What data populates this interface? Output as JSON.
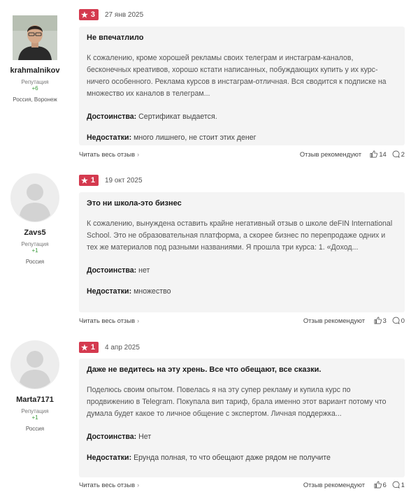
{
  "reviews": [
    {
      "user": {
        "name": "krahmalnikov",
        "rep_label": "Репутация",
        "rep_value": "+6",
        "location": "Россия, Воронеж",
        "avatar": "photo"
      },
      "rating": "3",
      "date": "27 янв 2025",
      "title": "Не впечатлило",
      "text": "К сожалению, кроме хорошей рекламы своих телеграм и инстаграм-каналов, бесконечных креативов, хорошо кстати написанных, побуждающих купить у их курс- ничего особенного. Реклама курсов в инстаграм-отличная. Вся сводится к подписке на множество их каналов в телеграм...",
      "pros_label": "Достоинства:",
      "pros": "Сертификат выдается.",
      "cons_label": "Недостатки:",
      "cons": "много лишнего, не стоит этих денег",
      "read_more": "Читать весь отзыв",
      "recommend": "Отзыв рекомендуют",
      "likes": "14",
      "comments": "2"
    },
    {
      "user": {
        "name": "Zavs5",
        "rep_label": "Репутация",
        "rep_value": "+1",
        "location": "Россия",
        "avatar": "default"
      },
      "rating": "1",
      "date": "19 окт 2025",
      "title": "Это ни школа-это бизнес",
      "text": "К сожалению, вынуждена оставить крайне негативный отзыв о школе deFIN International School. Это не образовательная платформа, а скорее бизнес по перепродаже одних и тех же материалов под разными названиями. Я прошла три курса: 1. «Доход...",
      "pros_label": "Достоинства:",
      "pros": "нет",
      "cons_label": "Недостатки:",
      "cons": "множество",
      "read_more": "Читать весь отзыв",
      "recommend": "Отзыв рекомендуют",
      "likes": "3",
      "comments": "0"
    },
    {
      "user": {
        "name": "Marta7171",
        "rep_label": "Репутация",
        "rep_value": "+1",
        "location": "Россия",
        "avatar": "default"
      },
      "rating": "1",
      "date": "4 апр 2025",
      "title": "Даже не ведитесь на эту хрень. Все что обещают, все сказки.",
      "text": "Поделюсь своим опытом. Повелась я на эту супер рекламу и купила курс по продвижению в Telegram. Покупала вип тариф, брала именно этот вариант потому что думала будет какое то личное общение с экспертом. Личная поддержка...",
      "pros_label": "Достоинства:",
      "pros": "Нет",
      "cons_label": "Недостатки:",
      "cons": "Ерунда полная, то что обещают даже рядом не получите",
      "read_more": "Читать весь отзыв",
      "recommend": "Отзыв рекомендуют",
      "likes": "6",
      "comments": "1"
    }
  ],
  "colors": {
    "rating_badge": "#d43a4f",
    "reputation": "#3a9a3a",
    "card_bg": "#f4f4f4"
  },
  "icons": {
    "rating": "star-icon",
    "read_more": "chevron-right-icon",
    "likes": "thumbs-up-icon",
    "comments": "comment-icon"
  }
}
